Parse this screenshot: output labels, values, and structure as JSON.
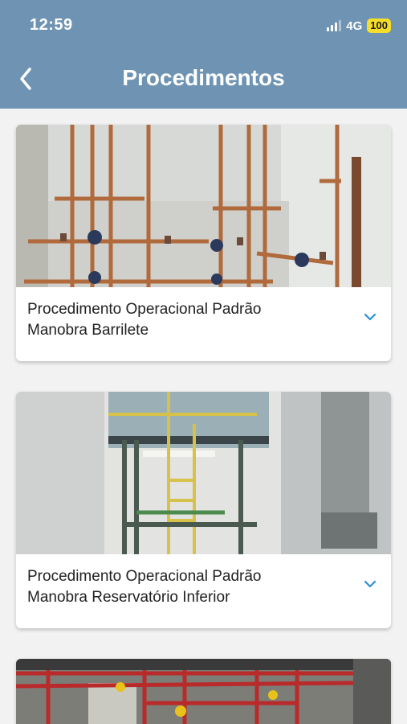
{
  "status_bar": {
    "time": "12:59",
    "network": "4G",
    "battery": "100"
  },
  "header": {
    "title": "Procedimentos"
  },
  "procedures": [
    {
      "line1": "Procedimento Operacional Padrão",
      "line2": "Manobra Barrilete"
    },
    {
      "line1": "Procedimento Operacional Padrão",
      "line2": "Manobra Reservatório Inferior"
    }
  ],
  "icons": {
    "back": "chevron-left-icon",
    "expand": "chevron-down-icon",
    "signal": "cellular-signal-icon",
    "battery": "battery-icon"
  },
  "colors": {
    "header": "#6f94b3",
    "accent": "#2a8fd6",
    "battery": "#f5dd2b"
  }
}
